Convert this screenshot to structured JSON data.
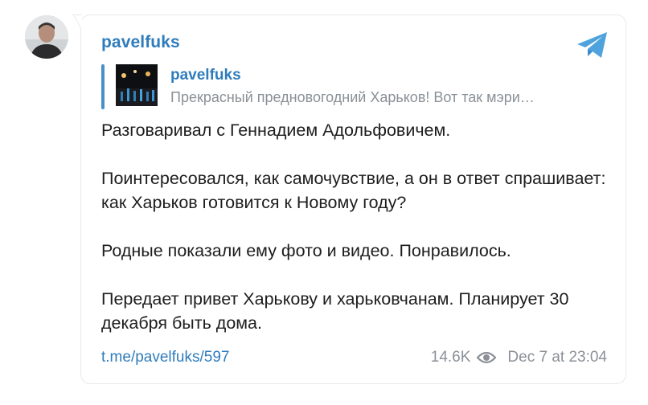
{
  "post": {
    "channel_name": "pavelfuks",
    "reply": {
      "name": "pavelfuks",
      "text": "Прекрасный предновогодний Харьков! Вот так мэри…"
    },
    "paragraphs": [
      "Разговаривал с Геннадием Адольфовичем.",
      "Поинтересовался, как самочувствие, а он в ответ спрашивает: как Харьков готовится к Новому году?",
      "Родные показали ему фото и видео. Понравилось.",
      "Передает привет Харькову и харьковчанам. Планирует 30 декабря быть дома."
    ],
    "link": "t.me/pavelfuks/597",
    "views": "14.6K",
    "date": "Dec 7 at 23:04"
  },
  "icons": {
    "share": "telegram-plane-icon",
    "views": "eye-icon"
  },
  "colors": {
    "accent": "#2f7cbc",
    "muted": "#8a9096",
    "text": "#1d1d1d",
    "reply_bar": "#4a90c8"
  }
}
